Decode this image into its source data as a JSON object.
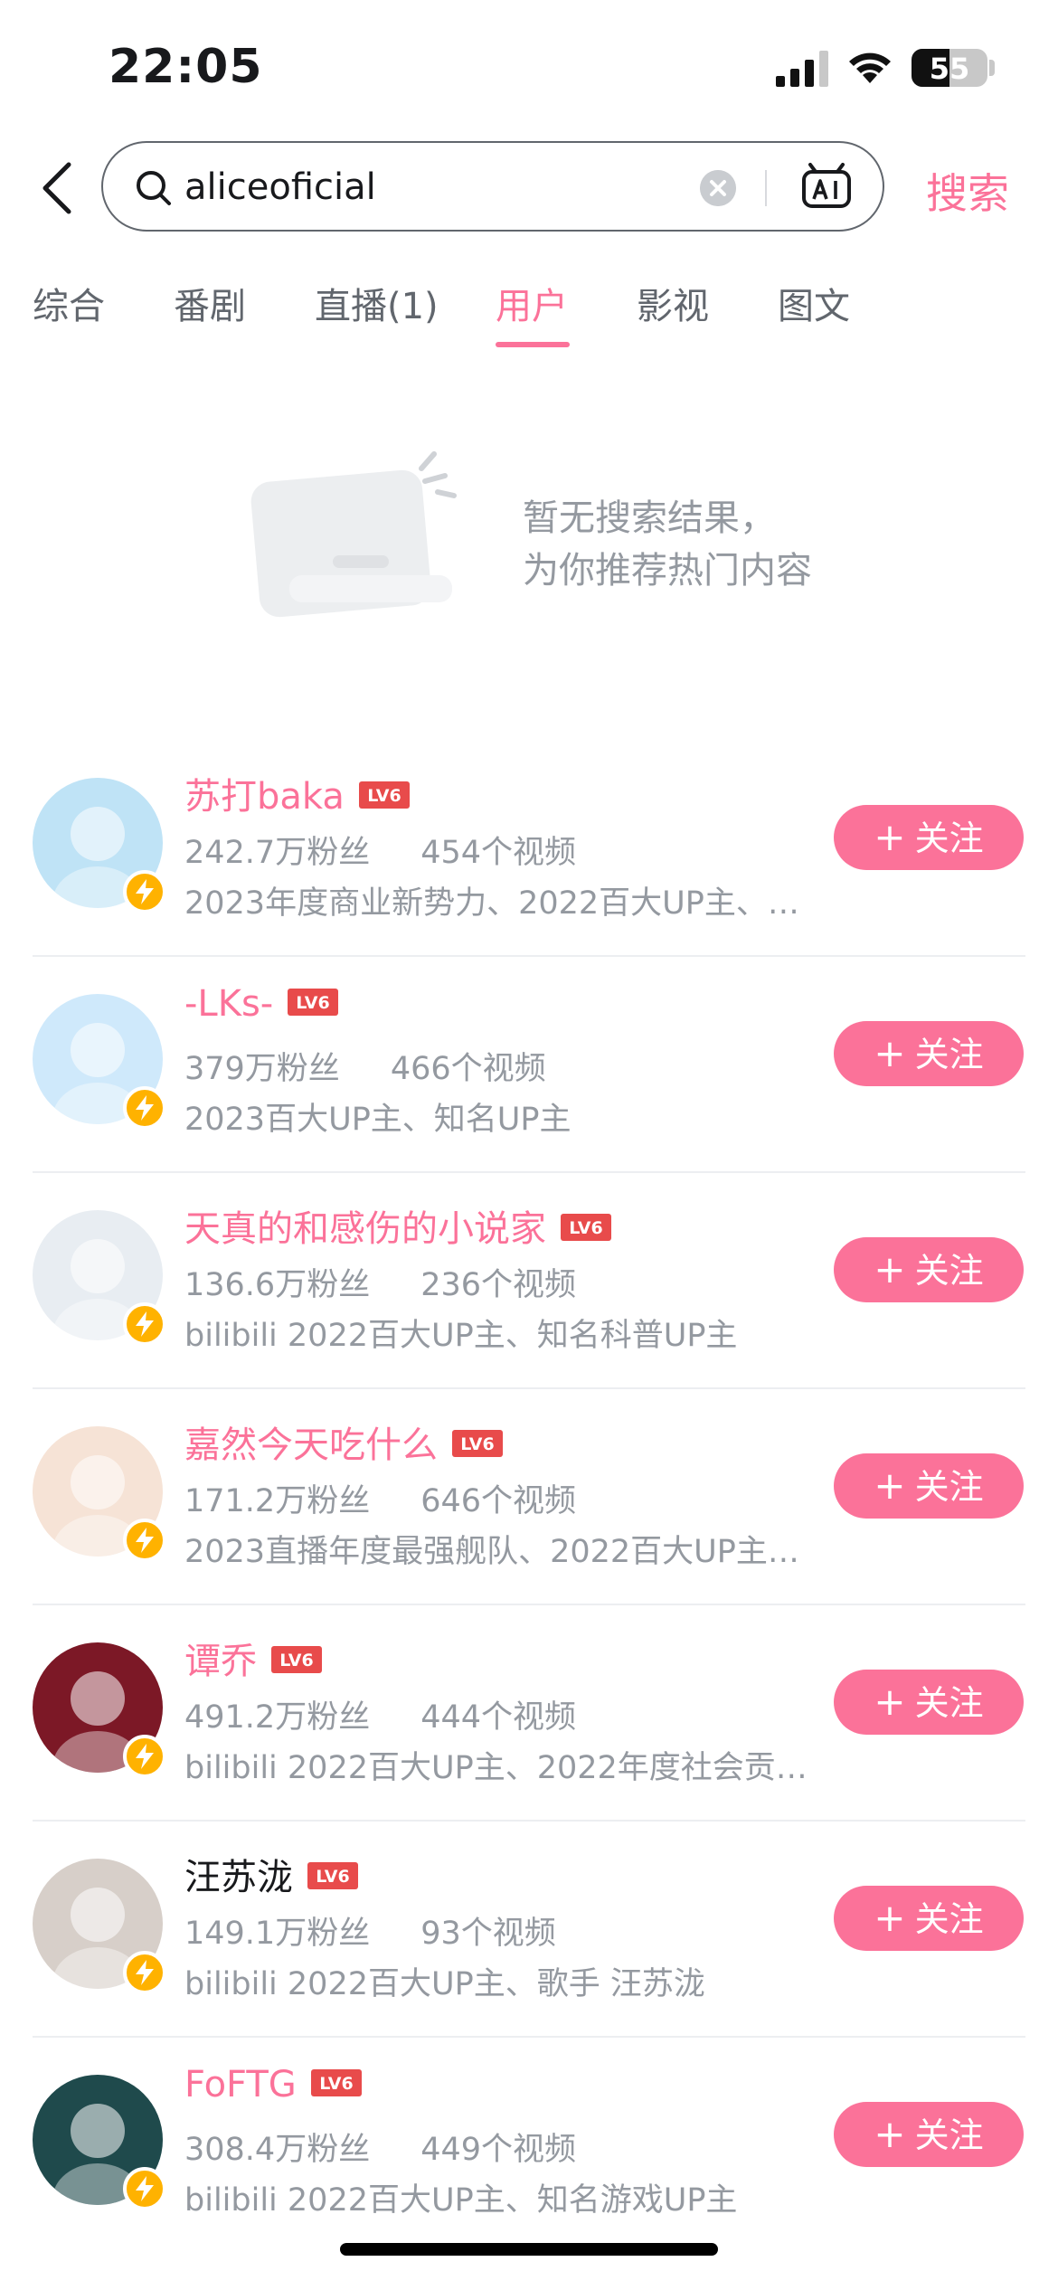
{
  "status_bar": {
    "time": "22:05",
    "battery": "55"
  },
  "search": {
    "query": "aliceoficial",
    "button": "搜索"
  },
  "tabs": [
    "综合",
    "番剧",
    "直播(1)",
    "用户",
    "影视",
    "图文"
  ],
  "active_tab": "用户",
  "empty_state": {
    "line1": "暂无搜索结果，",
    "line2": "为你推荐热门内容"
  },
  "follow_label": "关注",
  "level_label": "LV6",
  "users": [
    {
      "name": "苏打baka",
      "fans": "242.7万粉丝",
      "videos": "454个视频",
      "desc": "2023年度商业新势力、2022百大UP主、…",
      "name_color": "pink",
      "avatar_color": "#bfe3f6"
    },
    {
      "name": "-LKs-",
      "fans": "379万粉丝",
      "videos": "466个视频",
      "desc": "2023百大UP主、知名UP主",
      "name_color": "pink",
      "avatar_color": "#cfe9fb"
    },
    {
      "name": "天真的和感伤的小说家",
      "fans": "136.6万粉丝",
      "videos": "236个视频",
      "desc": "bilibili 2022百大UP主、知名科普UP主",
      "name_color": "pink",
      "avatar_color": "#e8edf2"
    },
    {
      "name": "嘉然今天吃什么",
      "fans": "171.2万粉丝",
      "videos": "646个视频",
      "desc": "2023直播年度最强舰队、2022百大UP主…",
      "name_color": "pink",
      "avatar_color": "#f6e3d6"
    },
    {
      "name": "谭乔",
      "fans": "491.2万粉丝",
      "videos": "444个视频",
      "desc": "bilibili 2022百大UP主、2022年度社会贡…",
      "name_color": "pink",
      "avatar_color": "#7c1826"
    },
    {
      "name": "汪苏泷",
      "fans": "149.1万粉丝",
      "videos": "93个视频",
      "desc": "bilibili 2022百大UP主、歌手 汪苏泷",
      "name_color": "black",
      "avatar_color": "#d7cfc9"
    },
    {
      "name": "FoFTG",
      "fans": "308.4万粉丝",
      "videos": "449个视频",
      "desc": "bilibili 2022百大UP主、知名游戏UP主",
      "name_color": "pink",
      "avatar_color": "#1f4a4c"
    }
  ],
  "colors": {
    "accent": "#fb7299",
    "level_badge": "#e84b4b",
    "verified_badge": "#ffb200"
  }
}
